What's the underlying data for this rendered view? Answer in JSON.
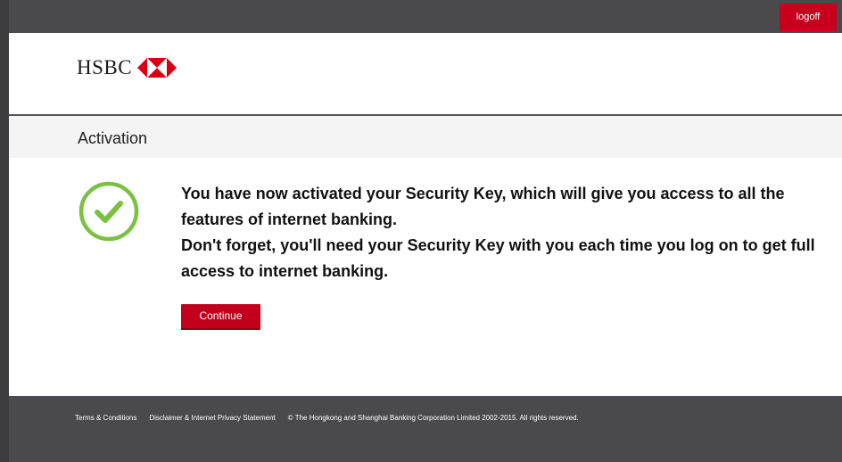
{
  "topbar": {
    "logoff_label": "logoff"
  },
  "header": {
    "logo_text": "HSBC"
  },
  "subheader": {
    "title": "Activation"
  },
  "content": {
    "message_line1": "You have now activated your Security Key, which will give you access to all the features of internet banking.",
    "message_line2": "Don't forget, you'll need your Security Key with you each time you log on to get full access to internet banking.",
    "continue_label": "Continue",
    "status_icon": "check-circle-icon"
  },
  "footer": {
    "terms_label": "Terms & Conditions",
    "disclaimer_label": "Disclaimer & Internet Privacy Statement",
    "copyright": "© The Hongkong and Shanghai Banking Corporation Limited 2002-2015. All rights reserved."
  },
  "colors": {
    "brand_red": "#c3001c",
    "topbar_bg": "#4a4a4c",
    "success_green": "#7ac142"
  }
}
